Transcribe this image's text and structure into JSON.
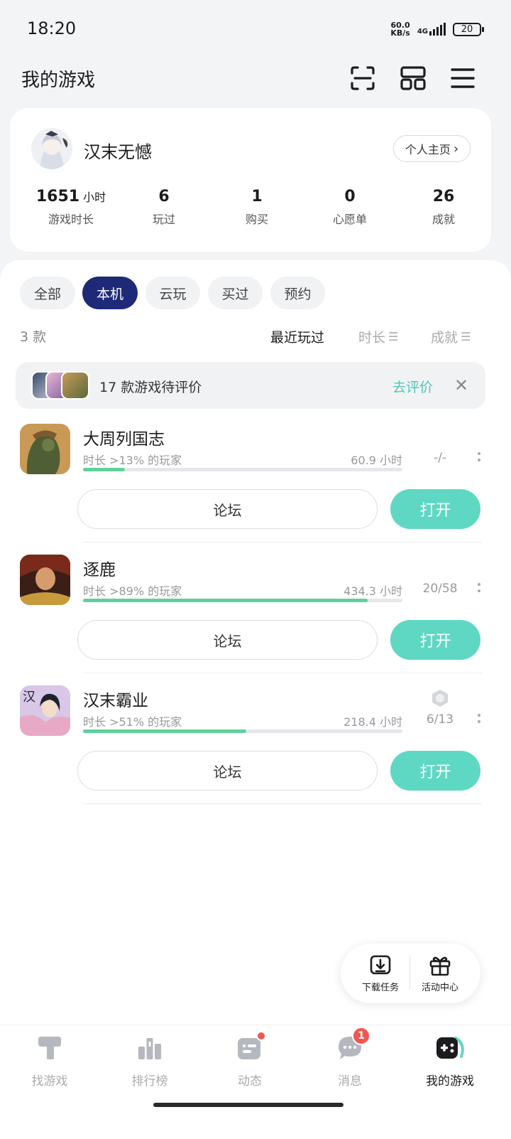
{
  "status": {
    "time": "18:20",
    "net_speed_top": "60.0",
    "net_speed_bottom": "KB/s",
    "network": "4G",
    "battery": "20"
  },
  "header": {
    "title": "我的游戏",
    "scan_icon": "scan-icon",
    "grid_icon": "grid-icon",
    "menu_icon": "menu-icon"
  },
  "profile": {
    "name": "汉末无憾",
    "home_label": "个人主页",
    "stats": [
      {
        "value": "1651",
        "unit": "小时",
        "label": "游戏时长"
      },
      {
        "value": "6",
        "unit": "",
        "label": "玩过"
      },
      {
        "value": "1",
        "unit": "",
        "label": "购买"
      },
      {
        "value": "0",
        "unit": "",
        "label": "心愿单"
      },
      {
        "value": "26",
        "unit": "",
        "label": "成就"
      }
    ]
  },
  "filters": {
    "chips": [
      "全部",
      "本机",
      "云玩",
      "买过",
      "预约"
    ],
    "selected": "本机"
  },
  "list": {
    "count": "3 款",
    "sorts": [
      {
        "label": "最近玩过",
        "active": true
      },
      {
        "label": "时长",
        "active": false
      },
      {
        "label": "成就",
        "active": false
      }
    ]
  },
  "review_banner": {
    "text": "17 款游戏待评价",
    "action": "去评价"
  },
  "games": [
    {
      "name": "大周列国志",
      "meta": "时长 >13% 的玩家",
      "hours": "60.9 小时",
      "progress": 0.13,
      "achievement": "-/-",
      "forum": "论坛",
      "open": "打开"
    },
    {
      "name": "逐鹿",
      "meta": "时长 >89% 的玩家",
      "hours": "434.3 小时",
      "progress": 0.89,
      "achievement": "20/58",
      "forum": "论坛",
      "open": "打开"
    },
    {
      "name": "汉末霸业",
      "meta": "时长 >51% 的玩家",
      "hours": "218.4 小时",
      "progress": 0.51,
      "achievement": "6/13",
      "forum": "论坛",
      "open": "打开"
    }
  ],
  "floating": {
    "download": "下载任务",
    "activity": "活动中心"
  },
  "nav": {
    "items": [
      "找游戏",
      "排行榜",
      "动态",
      "消息",
      "我的游戏"
    ],
    "active": "我的游戏",
    "message_badge": "1"
  },
  "colors": {
    "accent": "#5fd8c3",
    "chip_active": "#1e2a78",
    "progress": "#62cf9c",
    "badge": "#f0584f"
  }
}
